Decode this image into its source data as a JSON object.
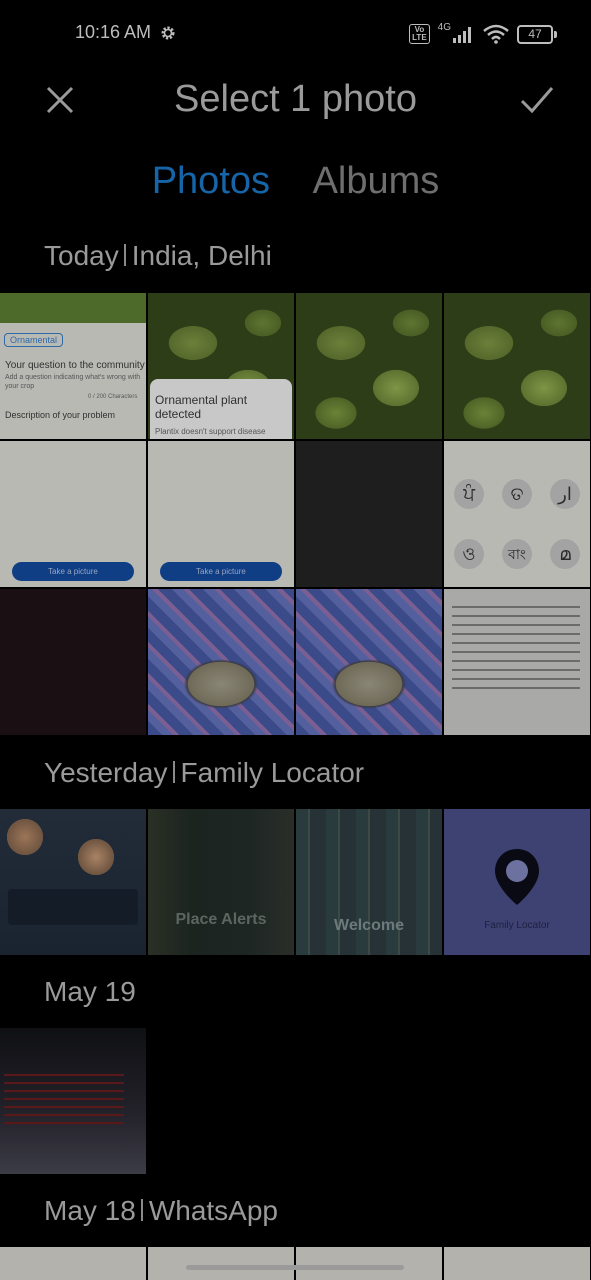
{
  "status_bar": {
    "time": "10:16 AM",
    "settings_icon": "gear-icon",
    "volte": "Vo\nLTE",
    "network": "4G",
    "battery": "47"
  },
  "header": {
    "title": "Select 1 photo",
    "close_icon": "close-icon",
    "confirm_icon": "check-icon"
  },
  "tabs": [
    {
      "label": "Photos",
      "active": true
    },
    {
      "label": "Albums",
      "active": false
    }
  ],
  "sections": [
    {
      "date": "Today",
      "place": "India, Delhi"
    },
    {
      "date": "Yesterday",
      "place": "Family Locator"
    },
    {
      "date": "May 19",
      "place": ""
    },
    {
      "date": "May 18",
      "place": "WhatsApp"
    }
  ],
  "thumbnails": {
    "ornamental_badge": "Ornamental",
    "question_heading": "Your question to the community",
    "question_sub": "Add a question indicating what's wrong with your crop",
    "char_count": "0 / 200 Characters",
    "description_heading": "Description of your problem",
    "plant_detected_title": "Ornamental plant detected",
    "plant_detected_sub": "Plantix doesn't support disease",
    "take_picture": "Take a picture",
    "scripts": [
      "ਪੰ",
      "ତ",
      "ار",
      "ও",
      "বাং",
      "മ"
    ],
    "place_alerts": "Place Alerts",
    "welcome": "Welcome",
    "family_locator": "Family Locator"
  }
}
